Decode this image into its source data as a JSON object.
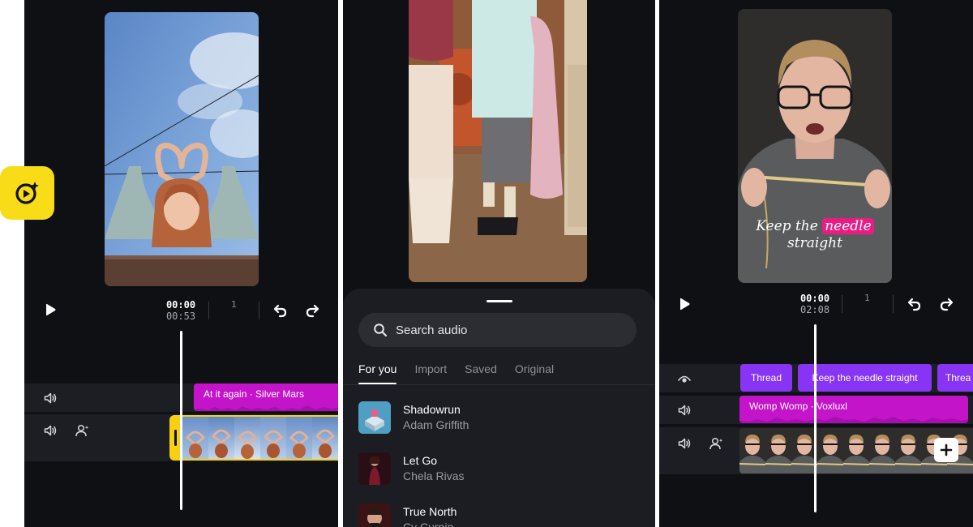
{
  "colors": {
    "background": "#ffffff",
    "editor_bg": "#0f1014",
    "track_bg": "#1c1e24",
    "audio_clip": "#c414c9",
    "title_clip": "#8834f5",
    "selection": "#f9cf12",
    "logo": "#f7dc17",
    "playhead": "#ffffff",
    "sheet_bg": "#1b1d22"
  },
  "logo": {
    "icon": "play-sparkle-icon"
  },
  "editor_left": {
    "time_current": "00:00",
    "time_total": "00:53",
    "ruler_label": "1",
    "audio_clip_label": "At it again · Silver Mars",
    "icons": [
      "play-icon",
      "undo-icon",
      "redo-icon",
      "volume-icon",
      "voiceover-icon"
    ]
  },
  "audio_picker": {
    "search_placeholder": "Search audio",
    "tabs": [
      {
        "label": "For you",
        "active": true
      },
      {
        "label": "Import",
        "active": false
      },
      {
        "label": "Saved",
        "active": false
      },
      {
        "label": "Original",
        "active": false
      }
    ],
    "songs": [
      {
        "title": "Shadowrun",
        "artist": "Adam Griffith"
      },
      {
        "title": "Let Go",
        "artist": "Chela Rivas"
      },
      {
        "title": "True North",
        "artist": "Cy Curnin"
      }
    ]
  },
  "editor_right": {
    "time_current": "00:00",
    "time_total": "02:08",
    "ruler_label": "1",
    "caption_line_1_pre": "Keep the",
    "caption_highlight": "needle",
    "caption_line_2": "straight",
    "title_clips": [
      "Thread",
      "Keep the needle straight",
      "Threa"
    ],
    "audio_clip_label": "Womp Womp · Voxluxl",
    "add_clip_icon": "plus-icon",
    "icons": [
      "play-icon",
      "undo-icon",
      "redo-icon",
      "eye-icon",
      "volume-icon",
      "voiceover-icon"
    ]
  }
}
